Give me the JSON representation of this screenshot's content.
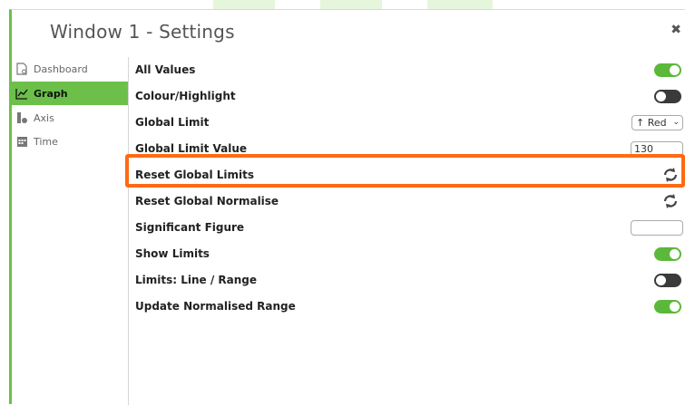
{
  "window": {
    "title": "Window 1 - Settings",
    "close_icon": "close-icon"
  },
  "sidebar": {
    "items": [
      {
        "label": "Dashboard",
        "icon": "dashboard-icon",
        "active": false
      },
      {
        "label": "Graph",
        "icon": "graph-icon",
        "active": true
      },
      {
        "label": "Axis",
        "icon": "axis-icon",
        "active": false
      },
      {
        "label": "Time",
        "icon": "calendar-icon",
        "active": false
      }
    ]
  },
  "settings": {
    "all_values": {
      "label": "All Values",
      "toggle": "on"
    },
    "colour_highlight": {
      "label": "Colour/Highlight",
      "toggle": "off"
    },
    "global_limit": {
      "label": "Global Limit",
      "selected": "↑ Red"
    },
    "global_limit_value": {
      "label": "Global Limit Value",
      "value": "130"
    },
    "reset_global_limits": {
      "label": "Reset Global Limits",
      "icon": "reset-icon"
    },
    "reset_global_normalise": {
      "label": "Reset Global Normalise",
      "icon": "reset-icon"
    },
    "significant_figure": {
      "label": "Significant Figure",
      "value": ""
    },
    "show_limits": {
      "label": "Show Limits",
      "toggle": "on"
    },
    "limits_line_range": {
      "label": "Limits: Line / Range",
      "toggle": "off"
    },
    "update_normalised_range": {
      "label": "Update Normalised Range",
      "toggle": "on"
    }
  },
  "colors": {
    "accent": "#6cc04a",
    "toggle_on": "#5cb83a",
    "toggle_off": "#3a3a3a",
    "highlight": "#ff6a13"
  }
}
